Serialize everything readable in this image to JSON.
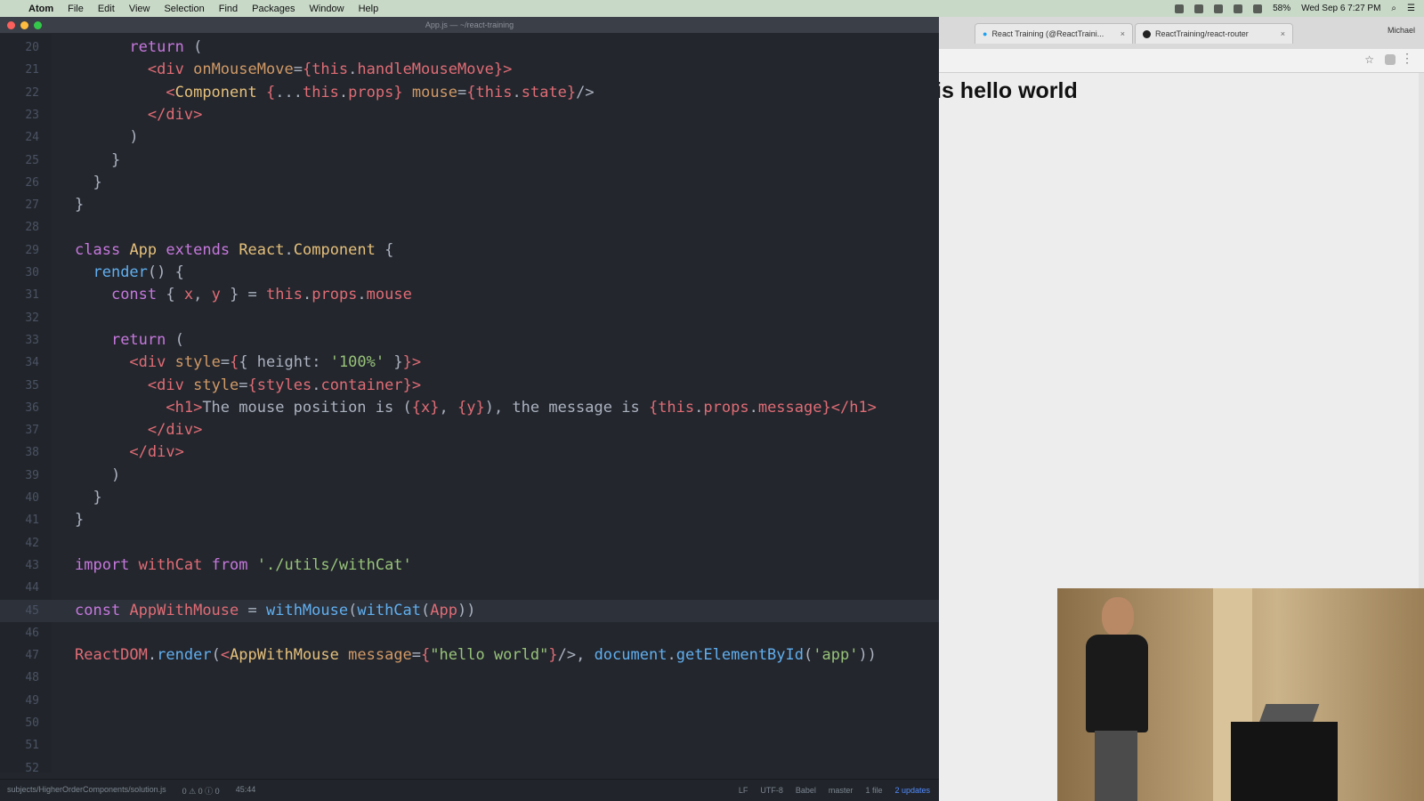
{
  "menubar": {
    "items": [
      "Atom",
      "File",
      "Edit",
      "View",
      "Selection",
      "Find",
      "Packages",
      "Window",
      "Help"
    ],
    "clock": "Wed Sep 6  7:27 PM",
    "battery": "58%"
  },
  "editor": {
    "window_title": "App.js — ~/react-training",
    "lines": [
      {
        "n": "20",
        "html": "      <span class=\"kw\">return</span> ("
      },
      {
        "n": "21",
        "html": "        <span class=\"tag\">&lt;div</span> <span class=\"attr\">onMouseMove</span>=<span class=\"tag\">{</span><span class=\"var\">this</span>.<span class=\"var\">handleMouseMove</span><span class=\"tag\">}</span><span class=\"tag\">&gt;</span>"
      },
      {
        "n": "22",
        "html": "          <span class=\"tag\">&lt;</span><span class=\"cls\">Component</span> <span class=\"tag\">{</span>...<span class=\"var\">this</span>.<span class=\"var\">props</span><span class=\"tag\">}</span> <span class=\"attr\">mouse</span>=<span class=\"tag\">{</span><span class=\"var\">this</span>.<span class=\"var\">state</span><span class=\"tag\">}</span>/&gt;"
      },
      {
        "n": "23",
        "html": "        <span class=\"tag\">&lt;/div&gt;</span>"
      },
      {
        "n": "24",
        "html": "      )"
      },
      {
        "n": "25",
        "html": "    }"
      },
      {
        "n": "26",
        "html": "  }"
      },
      {
        "n": "27",
        "html": "}"
      },
      {
        "n": "28",
        "html": ""
      },
      {
        "n": "29",
        "html": "<span class=\"kw\">class</span> <span class=\"cls\">App</span> <span class=\"kw\">extends</span> <span class=\"cls\">React</span>.<span class=\"cls\">Component</span> {"
      },
      {
        "n": "30",
        "html": "  <span class=\"fn\">render</span>() {"
      },
      {
        "n": "31",
        "html": "    <span class=\"kw\">const</span> { <span class=\"var\">x</span>, <span class=\"var\">y</span> } = <span class=\"var\">this</span>.<span class=\"var\">props</span>.<span class=\"var\">mouse</span>"
      },
      {
        "n": "32",
        "html": ""
      },
      {
        "n": "33",
        "html": "    <span class=\"kw\">return</span> ("
      },
      {
        "n": "34",
        "html": "      <span class=\"tag\">&lt;div</span> <span class=\"attr\">style</span>=<span class=\"tag\">{</span>{ <span class=\"plain\">height</span>: <span class=\"str\">'100%'</span> }<span class=\"tag\">}</span><span class=\"tag\">&gt;</span>"
      },
      {
        "n": "35",
        "html": "        <span class=\"tag\">&lt;div</span> <span class=\"attr\">style</span>=<span class=\"tag\">{</span><span class=\"var\">styles</span>.<span class=\"var\">container</span><span class=\"tag\">}</span><span class=\"tag\">&gt;</span>"
      },
      {
        "n": "36",
        "html": "          <span class=\"tag\">&lt;h1&gt;</span>The mouse position is (<span class=\"tag\">{</span><span class=\"var\">x</span><span class=\"tag\">}</span>, <span class=\"tag\">{</span><span class=\"var\">y</span><span class=\"tag\">}</span>), the message is <span class=\"tag\">{</span><span class=\"var\">this</span>.<span class=\"var\">props</span>.<span class=\"var\">message</span><span class=\"tag\">}</span><span class=\"tag\">&lt;/h1&gt;</span>"
      },
      {
        "n": "37",
        "html": "        <span class=\"tag\">&lt;/div&gt;</span>"
      },
      {
        "n": "38",
        "html": "      <span class=\"tag\">&lt;/div&gt;</span>"
      },
      {
        "n": "39",
        "html": "    )"
      },
      {
        "n": "40",
        "html": "  }"
      },
      {
        "n": "41",
        "html": "}"
      },
      {
        "n": "42",
        "html": ""
      },
      {
        "n": "43",
        "html": "<span class=\"kw\">import</span> <span class=\"var\">withCat</span> <span class=\"kw\">from</span> <span class=\"str\">'./utils/withCat'</span>"
      },
      {
        "n": "44",
        "html": ""
      },
      {
        "n": "45",
        "html": "<span class=\"kw\">const</span> <span class=\"var\">AppWithMouse</span> = <span class=\"fn\">withMouse</span>(<span class=\"fn\">withCat</span>(<span class=\"var\">App</span>))"
      },
      {
        "n": "46",
        "html": ""
      },
      {
        "n": "47",
        "html": "<span class=\"var\">ReactDOM</span>.<span class=\"fn\">render</span>(<span class=\"tag\">&lt;</span><span class=\"cls\">AppWithMouse</span> <span class=\"attr\">message</span>=<span class=\"tag\">{</span><span class=\"str\">\"hello world\"</span><span class=\"tag\">}</span>/&gt;, <span class=\"fn\">document</span>.<span class=\"fn\">getElementById</span>(<span class=\"str\">'app'</span>))"
      },
      {
        "n": "48",
        "html": ""
      },
      {
        "n": "49",
        "html": ""
      },
      {
        "n": "50",
        "html": ""
      },
      {
        "n": "51",
        "html": ""
      },
      {
        "n": "52",
        "html": ""
      }
    ],
    "active_line": "45",
    "status": {
      "file_path": "subjects/HigherOrderComponents/solution.js",
      "issues": "0 ⚠ 0 ⓘ 0",
      "cursor": "45:44",
      "line_ending": "LF",
      "encoding": "UTF-8",
      "grammar": "Babel",
      "git": "master",
      "files": "1 file",
      "updates": "2 updates"
    }
  },
  "browser": {
    "tabs": [
      {
        "label": "React Training (@ReactTraini...",
        "icon": "twitter-bird-icon"
      },
      {
        "label": "ReactTraining/react-router",
        "icon": "github-icon"
      }
    ],
    "profile": "Michael",
    "page_heading": "is hello world"
  },
  "colors": {
    "editor_bg": "#23262d",
    "keyword": "#c678dd",
    "class": "#e5c07b",
    "function": "#61afef",
    "tag": "#e06c75",
    "string": "#98c379",
    "attribute": "#d19a66"
  }
}
